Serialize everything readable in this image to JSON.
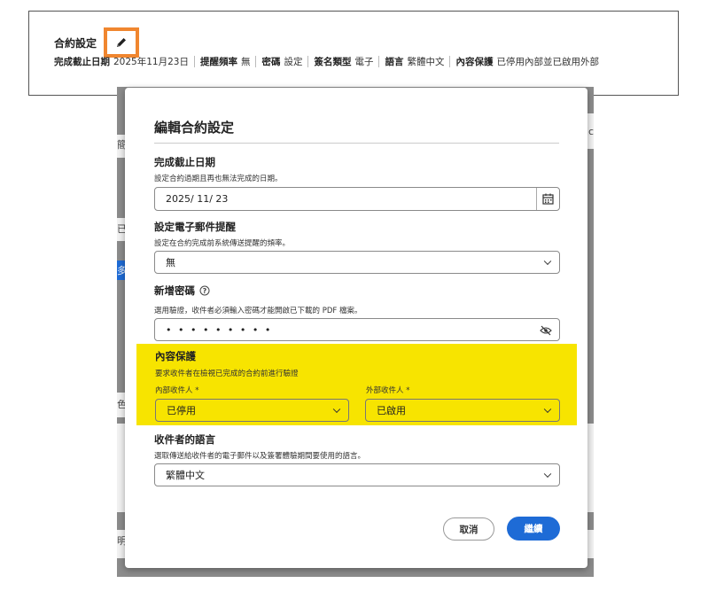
{
  "settings_bar": {
    "title": "合約設定",
    "edit_icon": "pencil-icon",
    "summary": {
      "due_date_label": "完成截止日期",
      "due_date_value": "2025年11月23日",
      "reminder_label": "提醒頻率",
      "reminder_value": "無",
      "password_label": "密碼",
      "password_value": "設定",
      "signature_type_label": "簽名類型",
      "signature_type_value": "電子",
      "language_label": "語言",
      "language_value": "繁體中文",
      "content_protection_label": "內容保護",
      "content_protection_value": "已停用內部並已啟用外部"
    }
  },
  "background_fragments": {
    "left_1": "簡",
    "left_2": "已",
    "left_3": "多",
    "left_4": "色",
    "left_5": "明",
    "right_1": "ic"
  },
  "modal": {
    "title": "編輯合約設定",
    "due_date": {
      "label": "完成截止日期",
      "description": "設定合約過期且再也無法完成的日期。",
      "value": "2025/ 11/ 23",
      "icon": "calendar-icon"
    },
    "reminder": {
      "label": "設定電子郵件提醒",
      "description": "設定在合約完成前系統傳送提醒的頻率。",
      "value": "無"
    },
    "password": {
      "label": "新增密碼",
      "help_icon": "help-circle-icon",
      "description": "選用驗證，收件者必須輸入密碼才能開啟已下載的 PDF 檔案。",
      "value": "• • • • • • • • •",
      "icon": "eye-slash-icon"
    },
    "content_protection": {
      "label": "內容保護",
      "description": "要求收件者在檢視已完成的合約前進行驗證",
      "internal_label": "內部收件人 *",
      "internal_value": "已停用",
      "external_label": "外部收件人 *",
      "external_value": "已啟用",
      "highlight_color": "#f7e400"
    },
    "recipient_language": {
      "label": "收件者的語言",
      "description": "選取傳送給收件者的電子郵件以及簽署體驗期間要使用的語言。",
      "value": "繁體中文"
    },
    "buttons": {
      "cancel": "取消",
      "continue": "繼續"
    }
  },
  "colors": {
    "accent": "#1e6bd6",
    "edit_outline": "#f0862f",
    "backdrop": "#8c8c8c"
  }
}
